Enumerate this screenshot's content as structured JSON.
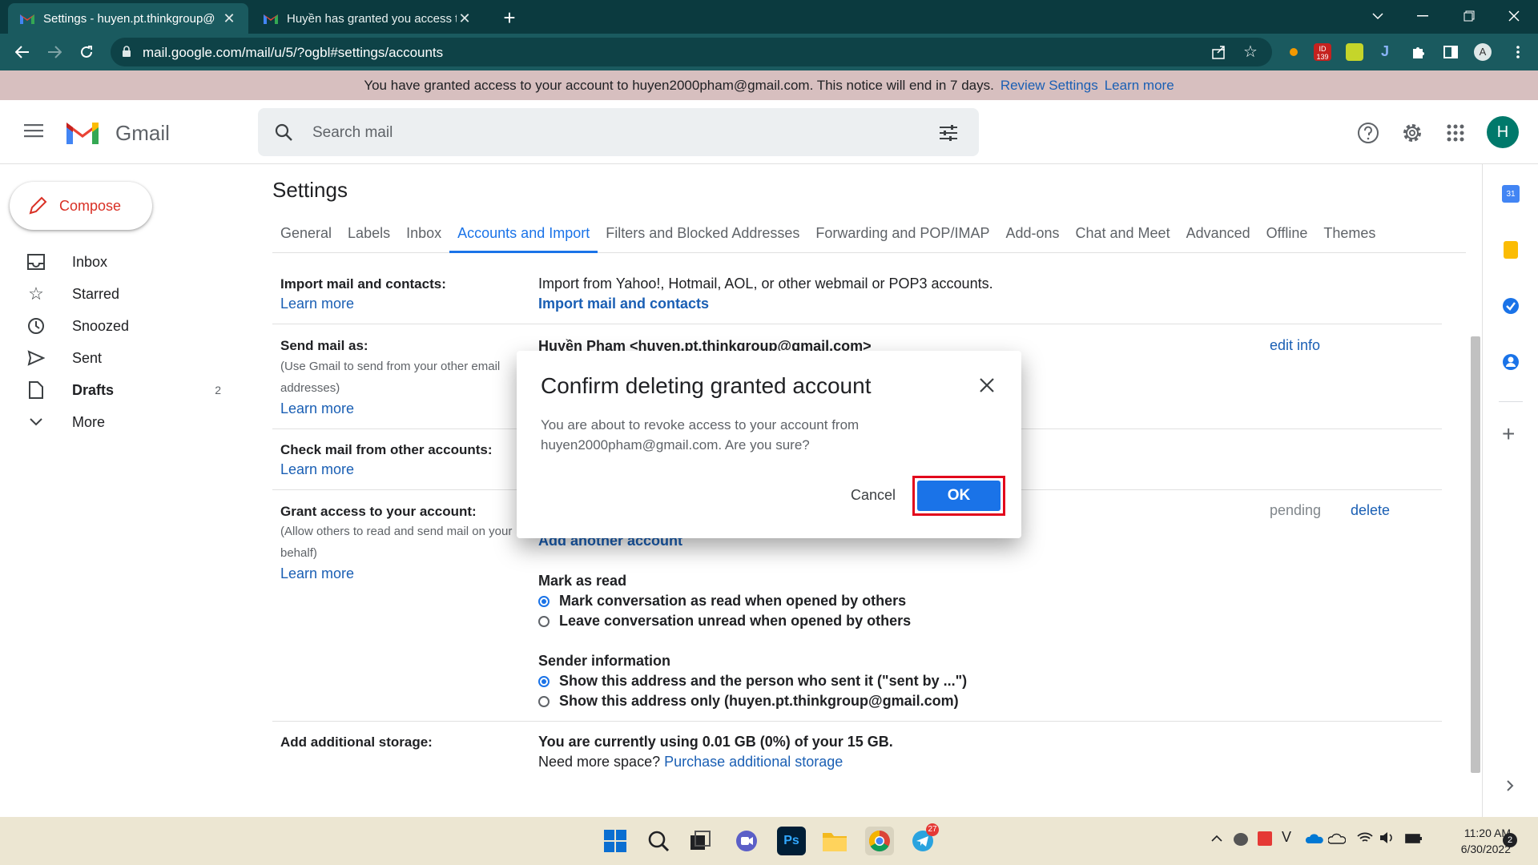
{
  "browser": {
    "tabs": [
      {
        "title": "Settings - huyen.pt.thinkgroup@",
        "active": true
      },
      {
        "title": "Huyền has granted you access to",
        "active": false
      }
    ],
    "url": "mail.google.com/mail/u/5/?ogbl#settings/accounts",
    "ext_badge": "139"
  },
  "notice": {
    "text": "You have granted access to your account to huyen2000pham@gmail.com. This notice will end in 7 days.",
    "review_link": "Review Settings",
    "learn_link": "Learn more"
  },
  "gmail": {
    "brand": "Gmail",
    "search_placeholder": "Search mail",
    "avatar_letter": "H"
  },
  "nav": {
    "compose": "Compose",
    "items": [
      {
        "label": "Inbox",
        "count": ""
      },
      {
        "label": "Starred",
        "count": ""
      },
      {
        "label": "Snoozed",
        "count": ""
      },
      {
        "label": "Sent",
        "count": ""
      },
      {
        "label": "Drafts",
        "count": "2"
      },
      {
        "label": "More",
        "count": ""
      }
    ]
  },
  "settings": {
    "title": "Settings",
    "tabs": [
      "General",
      "Labels",
      "Inbox",
      "Accounts and Import",
      "Filters and Blocked Addresses",
      "Forwarding and POP/IMAP",
      "Add-ons",
      "Chat and Meet",
      "Advanced",
      "Offline",
      "Themes"
    ],
    "active_tab": "Accounts and Import",
    "import": {
      "label": "Import mail and contacts:",
      "learn": "Learn more",
      "desc": "Import from Yahoo!, Hotmail, AOL, or other webmail or POP3 accounts.",
      "action": "Import mail and contacts"
    },
    "sendas": {
      "label": "Send mail as:",
      "sub": "(Use Gmail to send from your other email addresses)",
      "learn": "Learn more",
      "value": "Huyền Pham <huyen.pt.thinkgroup@gmail.com>",
      "edit": "edit info"
    },
    "checkmail": {
      "label": "Check mail from other accounts:",
      "learn": "Learn more"
    },
    "grant": {
      "label": "Grant access to your account:",
      "sub": "(Allow others to read and send mail on your behalf)",
      "learn": "Learn more",
      "add": "Add another account",
      "status": "pending",
      "delete": "delete",
      "markread_title": "Mark as read",
      "markread_opts": [
        "Mark conversation as read when opened by others",
        "Leave conversation unread when opened by others"
      ],
      "sender_title": "Sender information",
      "sender_opts": [
        "Show this address and the person who sent it (\"sent by ...\")",
        "Show this address only (huyen.pt.thinkgroup@gmail.com)"
      ]
    },
    "storage": {
      "label": "Add additional storage:",
      "usage": "You are currently using 0.01 GB (0%) of your 15 GB.",
      "need": "Need more space?",
      "purchase": "Purchase additional storage"
    }
  },
  "dialog": {
    "title": "Confirm deleting granted account",
    "body": "You are about to revoke access to your account from huyen2000pham@gmail.com. Are you sure?",
    "cancel": "Cancel",
    "ok": "OK"
  },
  "taskbar": {
    "time": "11:20 AM",
    "date": "6/30/2022",
    "chrome_badge": "27",
    "notif_count": "2"
  }
}
